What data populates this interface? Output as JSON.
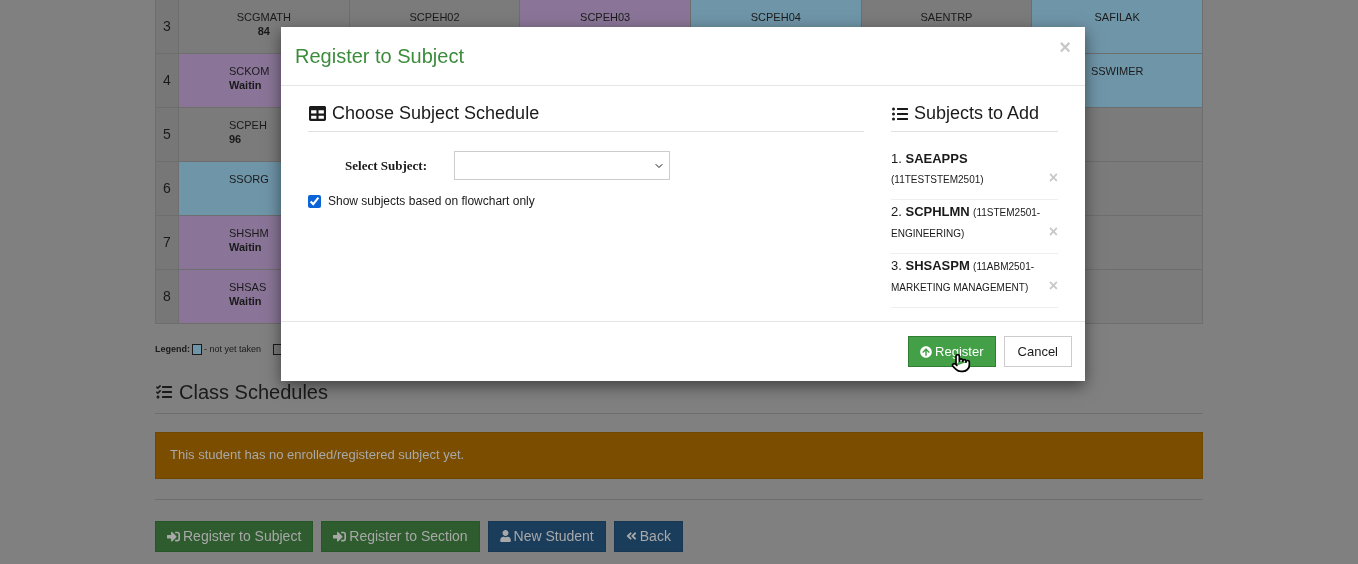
{
  "schedule_grid": {
    "rows": [
      {
        "number": "3",
        "cells": [
          {
            "name": "SCGMATH",
            "note": "84",
            "color": "#7b7b7b"
          },
          {
            "name": "SCPEH02",
            "color": "#7b7b7b"
          },
          {
            "name": "SCPEH03",
            "color": "#8a7598"
          },
          {
            "name": "SCPEH04",
            "color": "#6f95a8"
          },
          {
            "name": "SAENTRP",
            "color": "#7b7b7b"
          },
          {
            "name": "SAFILAK",
            "color": "#6f95a8"
          }
        ]
      },
      {
        "number": "4",
        "cells": [
          {
            "name": "SCKOM",
            "note": "Waitin",
            "color": "#8a7598"
          },
          "",
          "",
          "",
          "",
          {
            "name": "SSWIMER",
            "color": "#6f95a8"
          }
        ]
      },
      {
        "number": "5",
        "cells": [
          {
            "name": "SCPEH",
            "note": "96",
            "color": "#7b7b7b"
          },
          "",
          "",
          "",
          "",
          {
            "color": "#7b7b7b"
          }
        ]
      },
      {
        "number": "6",
        "cells": [
          {
            "name": "SSORG",
            "color": "#6f95a8"
          },
          "",
          "",
          "",
          "",
          {
            "color": "#7b7b7b"
          }
        ]
      },
      {
        "number": "7",
        "cells": [
          {
            "name": "SHSHM",
            "note": "Waitin",
            "color": "#8a7598"
          },
          "",
          "",
          "",
          "",
          {
            "color": "#7b7b7b"
          }
        ]
      },
      {
        "number": "8",
        "cells": [
          {
            "name": "SHSAS",
            "note": "Waitin",
            "color": "#8a7598"
          },
          "",
          "",
          "",
          "",
          {
            "color": "#7b7b7b"
          }
        ]
      }
    ]
  },
  "legend": {
    "label": "Legend:",
    "items": [
      {
        "color": "#6f95a8",
        "text": "- not yet taken"
      },
      {
        "color": "#7b7b7b"
      }
    ]
  },
  "class_schedules": {
    "title": "Class Schedules",
    "alert": "This student has no enrolled/registered subject yet."
  },
  "actions": [
    {
      "label": "Register to Subject",
      "kind": "register"
    },
    {
      "label": "Register to Section",
      "kind": "register"
    },
    {
      "label": "New Student",
      "kind": "new"
    },
    {
      "label": "Back",
      "kind": "back"
    }
  ],
  "modal": {
    "title": "Register to Subject",
    "close": "×",
    "schedule": {
      "title": "Choose Subject Schedule",
      "select_label": "Select Subject:",
      "flowchart_only": {
        "label": "Show subjects based on flowchart only",
        "checked": true
      }
    },
    "subjects_to_add": {
      "title": "Subjects to Add",
      "items": [
        {
          "number": "1.",
          "code": "SAEAPPS",
          "section": "(11TESTSTEM2501)",
          "remove": "×"
        },
        {
          "number": "2.",
          "code": "SCPHLMN",
          "section": "(11STEM2501-ENGINEERING)",
          "remove": "×"
        },
        {
          "number": "3.",
          "code": "SHSASPM",
          "section": "(11ABM2501-MARKETING MANAGEMENT)",
          "remove": "×"
        }
      ]
    },
    "buttons": [
      {
        "label": "Register",
        "kind": "primary"
      },
      {
        "label": "Cancel",
        "kind": "default"
      }
    ]
  }
}
